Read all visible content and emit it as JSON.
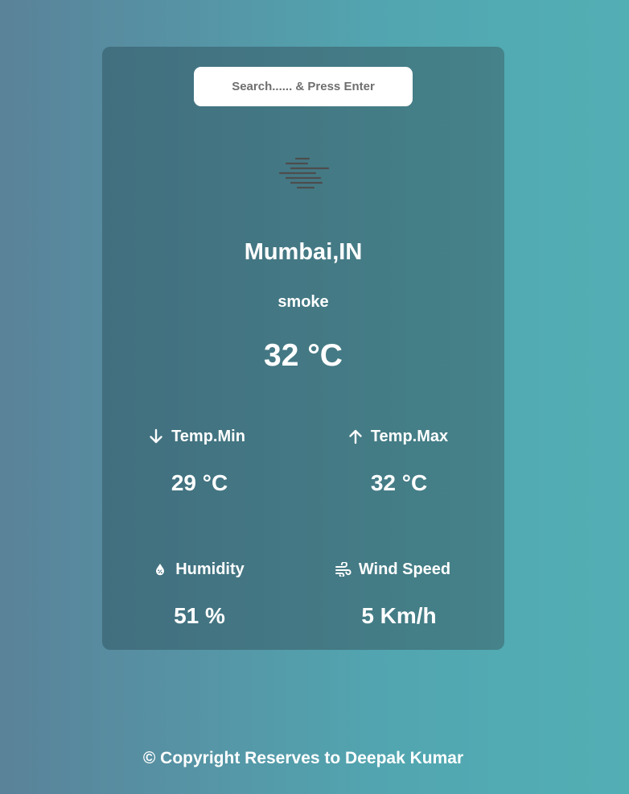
{
  "search": {
    "placeholder": "Search...... & Press Enter",
    "value": ""
  },
  "weather": {
    "icon": "haze-smoke-icon",
    "city": "Mumbai,IN",
    "condition": "smoke",
    "temperature": "32 °C"
  },
  "stats": {
    "temp_min": {
      "label": "Temp.Min",
      "value": "29 °C",
      "icon": "arrow-down-icon"
    },
    "temp_max": {
      "label": "Temp.Max",
      "value": "32 °C",
      "icon": "arrow-up-icon"
    },
    "humidity": {
      "label": "Humidity",
      "value": "51 %",
      "icon": "droplet-icon"
    },
    "wind": {
      "label": "Wind Speed",
      "value": "5 Km/h",
      "icon": "wind-icon"
    }
  },
  "footer": {
    "text": "© Copyright Reserves to Deepak Kumar"
  },
  "colors": {
    "background_left": "#5a8299",
    "background_right": "#52afb4",
    "card": "#436f80",
    "icon_lines": "#4d4d4d",
    "text": "#ffffff"
  }
}
